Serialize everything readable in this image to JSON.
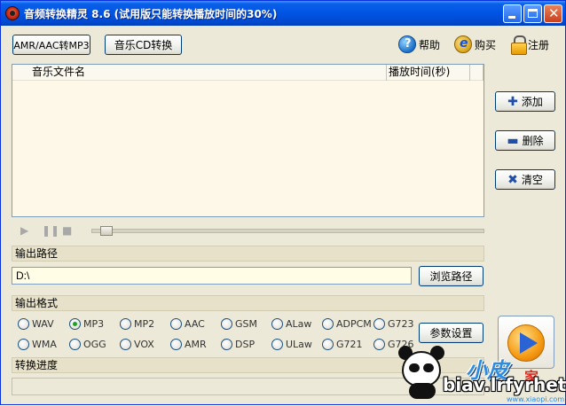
{
  "window": {
    "title": "音频转换精灵 8.6 (试用版只能转换播放时间的30%)"
  },
  "toolbar": {
    "amr_button": "AMR/AAC转MP3",
    "cd_button": "音乐CD转换",
    "help_label": "帮助",
    "buy_label": "购买",
    "register_label": "注册"
  },
  "file_list": {
    "columns": [
      "音乐文件名",
      "播放时间(秒)"
    ],
    "rows": []
  },
  "side_buttons": {
    "add": "添加",
    "delete": "删除",
    "clear": "清空"
  },
  "player": {
    "play_icon": "play-icon",
    "pause_icon": "pause-icon",
    "stop_icon": "stop-icon",
    "seek_position": 0
  },
  "output_path": {
    "section_label": "输出路径",
    "value": "D:\\",
    "browse_button": "浏览路径"
  },
  "output_format": {
    "section_label": "输出格式",
    "options": [
      "WAV",
      "MP3",
      "MP2",
      "AAC",
      "GSM",
      "ALaw",
      "ADPCM",
      "G723",
      "WMA",
      "OGG",
      "VOX",
      "AMR",
      "DSP",
      "ULaw",
      "G721",
      "G726"
    ],
    "selected": "MP3",
    "settings_button": "参数设置"
  },
  "progress": {
    "section_label": "转换进度",
    "value": 0
  },
  "watermark": {
    "logo_text": "小皮",
    "logo_text2": "家",
    "site_text": "biav.lrfyrhet",
    "small_text": "www.xiaopi.com"
  },
  "colors": {
    "titlebar": "#0054e3",
    "list_bg": "#fdf8e8",
    "section_bg": "#e6e1c8",
    "accent_green": "#21a121"
  }
}
